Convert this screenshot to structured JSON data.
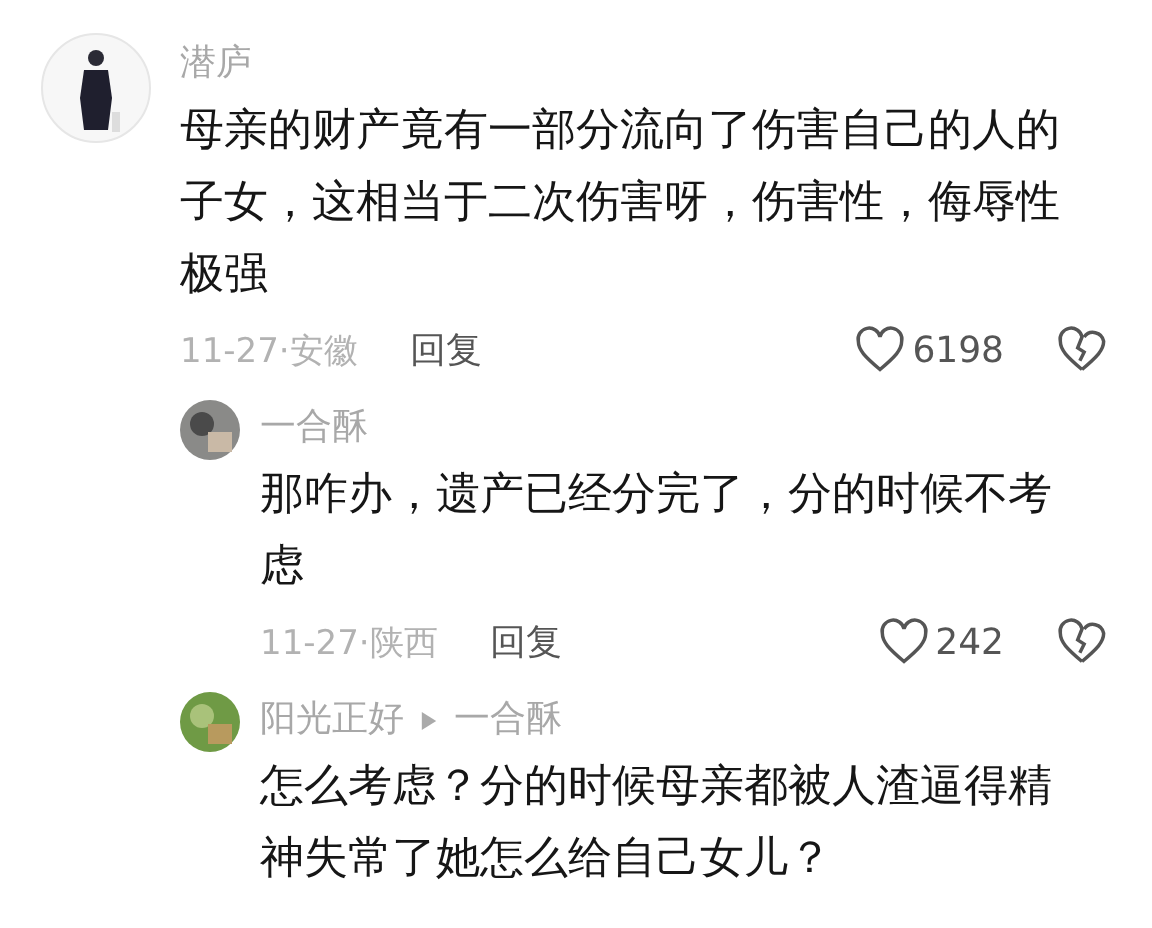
{
  "comments": [
    {
      "author": "潜庐",
      "text": "母亲的财产竟有一部分流向了伤害自己的人的子女，这相当于二次伤害呀，伤害性，侮辱性极强",
      "date": "11-27·安徽",
      "reply": "回复",
      "likes": "6198",
      "children": [
        {
          "author": "一合酥",
          "text": "那咋办，遗产已经分完了，分的时候不考虑",
          "date": "11-27·陕西",
          "reply": "回复",
          "likes": "242"
        },
        {
          "author": "阳光正好",
          "reply_to": "一合酥",
          "text": "怎么考虑？分的时候母亲都被人渣逼得精神失常了她怎么给自己女儿？"
        }
      ]
    }
  ]
}
